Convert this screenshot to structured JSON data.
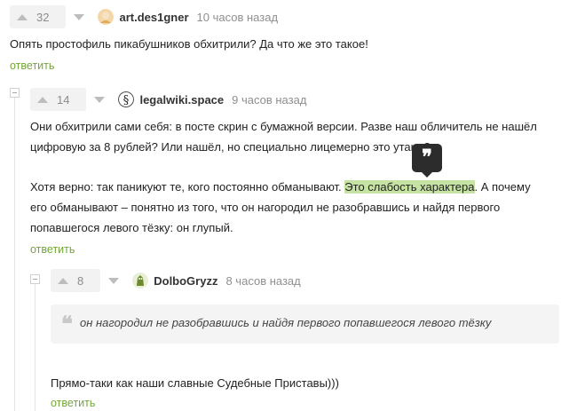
{
  "comments": [
    {
      "rating": "32",
      "username": "art.des1gner",
      "time": "10 часов назад",
      "lines": [
        "Опять простофиль пикабушников обхитрили? Да что же это такое!"
      ],
      "reply_label": "ответить"
    },
    {
      "rating": "14",
      "username": "legalwiki.space",
      "time": "9 часов назад",
      "lines": [
        "Они обхитрили сами себя: в посте скрин с бумажной версии. Разве наш обличитель не нашёл",
        "цифровую за 8 рублей? Или нашёл, но специально лицемерно это утаил?"
      ],
      "para2_before": "Хотя верно: так паникуют те, кого постоянно обманывают. ",
      "para2_highlight": "Это слабость характера",
      "para2_after": ". А почему",
      "para2_lines": [
        "его обманывают – понятно из того, что он нагородил не разобравшись и найдя первого",
        "попавшегося левого тёзку: он глупый."
      ],
      "reply_label": "ответить"
    },
    {
      "rating": "8",
      "username": "DolboGryzz",
      "time": "8 часов назад",
      "quote": "он нагородил не разобравшись и найдя первого попавшегося левого тёзку",
      "lines": [
        "Прямо-таки как наши славные Судебные Приставы)))"
      ],
      "reply_label": "ответить"
    }
  ],
  "tooltip": {
    "icon": "quote-icon",
    "glyph": "❞"
  },
  "colors": {
    "accent": "#74a63b",
    "highlight": "#c6e3a4",
    "tooltip_bg": "#2c2c2c"
  }
}
